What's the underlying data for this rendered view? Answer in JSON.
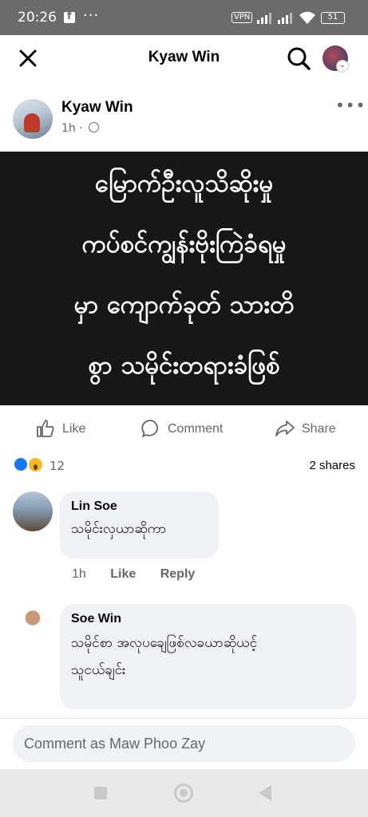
{
  "status_bar": {
    "time": "20:26",
    "more": "···",
    "vpn": "VPN",
    "battery": "51"
  },
  "header": {
    "title": "Kyaw Win"
  },
  "post": {
    "author": "Kyaw Win",
    "time": "1h ·",
    "image_lines": [
      "မြောက်ဦးလူသိဆိုးမှု",
      "ကပ်စင်ကျွန်းဗိုးကြဲခံရမှု",
      "မှာ ကျောက်ခုတ် သားတိ",
      "စွာ သမိုင်းတရားခံဖြစ်"
    ]
  },
  "actions": {
    "like": "Like",
    "comment": "Comment",
    "share": "Share"
  },
  "reactions": {
    "count": "12",
    "shares": "2 shares"
  },
  "comments": [
    {
      "name": "Lin Soe",
      "text": "သမိုင်းလှယာဆိုကာ",
      "time": "1h",
      "like": "Like",
      "reply": "Reply"
    },
    {
      "name": "Soe Win",
      "text_lines": [
        "သမိုင်စာ အလုပချေဖြစ်လခယာဆိုယင့်",
        "သူငယ်ချင်း"
      ]
    }
  ],
  "composer": {
    "placeholder": "Comment as Maw Phoo Zay"
  },
  "colors": {
    "accent": "#1877f2",
    "muted": "#65676b",
    "bubble": "#f0f2f5",
    "status_bar": "#6b6b6b"
  }
}
